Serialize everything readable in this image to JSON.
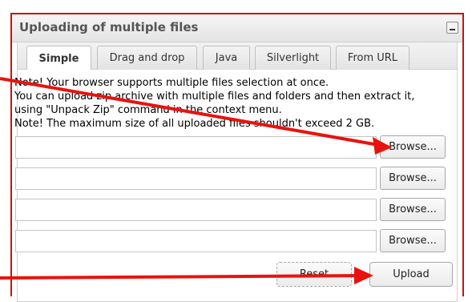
{
  "panel": {
    "title": "Uploading of multiple files",
    "minimize_icon": "minimize-icon"
  },
  "tabs": [
    {
      "label": "Simple",
      "active": true
    },
    {
      "label": "Drag and drop",
      "active": false
    },
    {
      "label": "Java",
      "active": false
    },
    {
      "label": "Silverlight",
      "active": false
    },
    {
      "label": "From URL",
      "active": false
    }
  ],
  "notes": [
    "Note! Your browser supports multiple files selection at once.",
    "You can upload zip archive with multiple files and folders and then extract it,",
    "using \"Unpack Zip\" command in the context menu.",
    "Note! The maximum size of all uploaded files shouldn't exceed 2 GB."
  ],
  "file_rows": [
    {
      "value": "",
      "browse_label": "Browse..."
    },
    {
      "value": "",
      "browse_label": "Browse..."
    },
    {
      "value": "",
      "browse_label": "Browse..."
    },
    {
      "value": "",
      "browse_label": "Browse..."
    }
  ],
  "actions": {
    "reset_label": "Reset",
    "upload_label": "Upload"
  },
  "colors": {
    "annotation_arrow": "#e8130e",
    "panel_border": "#c9120c"
  }
}
